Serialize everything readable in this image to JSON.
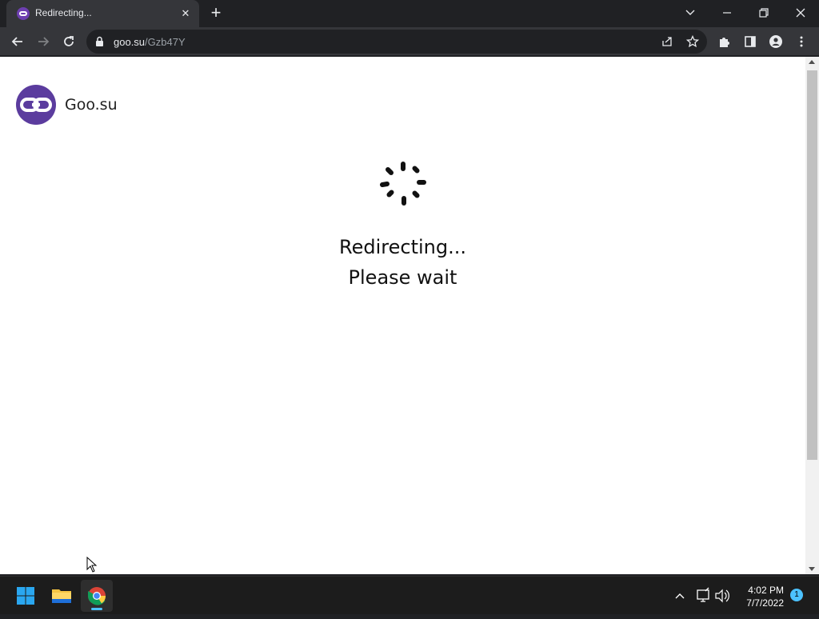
{
  "browser": {
    "tab": {
      "title": "Redirecting...",
      "close_glyph": "✕"
    },
    "new_tab_glyph": "+",
    "omnibox": {
      "host": "goo.su",
      "path": "/Gzb47Y"
    }
  },
  "page": {
    "logo_text": "Goo.su",
    "message_line1": "Redirecting...",
    "message_line2": "Please wait"
  },
  "taskbar": {
    "clock_time": "4:02 PM",
    "clock_date": "7/7/2022",
    "notification_count": "1"
  },
  "colors": {
    "logo_purple": "#5b3c9e",
    "taskbar_accent": "#4cc2ff"
  }
}
